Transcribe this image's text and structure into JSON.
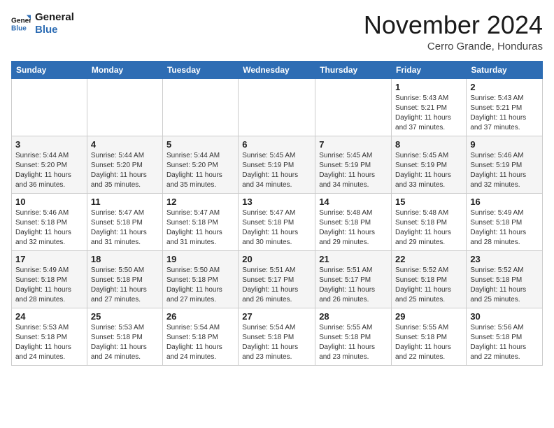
{
  "logo": {
    "line1": "General",
    "line2": "Blue"
  },
  "title": "November 2024",
  "subtitle": "Cerro Grande, Honduras",
  "header_days": [
    "Sunday",
    "Monday",
    "Tuesday",
    "Wednesday",
    "Thursday",
    "Friday",
    "Saturday"
  ],
  "weeks": [
    [
      {
        "day": "",
        "info": ""
      },
      {
        "day": "",
        "info": ""
      },
      {
        "day": "",
        "info": ""
      },
      {
        "day": "",
        "info": ""
      },
      {
        "day": "",
        "info": ""
      },
      {
        "day": "1",
        "info": "Sunrise: 5:43 AM\nSunset: 5:21 PM\nDaylight: 11 hours and 37 minutes."
      },
      {
        "day": "2",
        "info": "Sunrise: 5:43 AM\nSunset: 5:21 PM\nDaylight: 11 hours and 37 minutes."
      }
    ],
    [
      {
        "day": "3",
        "info": "Sunrise: 5:44 AM\nSunset: 5:20 PM\nDaylight: 11 hours and 36 minutes."
      },
      {
        "day": "4",
        "info": "Sunrise: 5:44 AM\nSunset: 5:20 PM\nDaylight: 11 hours and 35 minutes."
      },
      {
        "day": "5",
        "info": "Sunrise: 5:44 AM\nSunset: 5:20 PM\nDaylight: 11 hours and 35 minutes."
      },
      {
        "day": "6",
        "info": "Sunrise: 5:45 AM\nSunset: 5:19 PM\nDaylight: 11 hours and 34 minutes."
      },
      {
        "day": "7",
        "info": "Sunrise: 5:45 AM\nSunset: 5:19 PM\nDaylight: 11 hours and 34 minutes."
      },
      {
        "day": "8",
        "info": "Sunrise: 5:45 AM\nSunset: 5:19 PM\nDaylight: 11 hours and 33 minutes."
      },
      {
        "day": "9",
        "info": "Sunrise: 5:46 AM\nSunset: 5:19 PM\nDaylight: 11 hours and 32 minutes."
      }
    ],
    [
      {
        "day": "10",
        "info": "Sunrise: 5:46 AM\nSunset: 5:18 PM\nDaylight: 11 hours and 32 minutes."
      },
      {
        "day": "11",
        "info": "Sunrise: 5:47 AM\nSunset: 5:18 PM\nDaylight: 11 hours and 31 minutes."
      },
      {
        "day": "12",
        "info": "Sunrise: 5:47 AM\nSunset: 5:18 PM\nDaylight: 11 hours and 31 minutes."
      },
      {
        "day": "13",
        "info": "Sunrise: 5:47 AM\nSunset: 5:18 PM\nDaylight: 11 hours and 30 minutes."
      },
      {
        "day": "14",
        "info": "Sunrise: 5:48 AM\nSunset: 5:18 PM\nDaylight: 11 hours and 29 minutes."
      },
      {
        "day": "15",
        "info": "Sunrise: 5:48 AM\nSunset: 5:18 PM\nDaylight: 11 hours and 29 minutes."
      },
      {
        "day": "16",
        "info": "Sunrise: 5:49 AM\nSunset: 5:18 PM\nDaylight: 11 hours and 28 minutes."
      }
    ],
    [
      {
        "day": "17",
        "info": "Sunrise: 5:49 AM\nSunset: 5:18 PM\nDaylight: 11 hours and 28 minutes."
      },
      {
        "day": "18",
        "info": "Sunrise: 5:50 AM\nSunset: 5:18 PM\nDaylight: 11 hours and 27 minutes."
      },
      {
        "day": "19",
        "info": "Sunrise: 5:50 AM\nSunset: 5:18 PM\nDaylight: 11 hours and 27 minutes."
      },
      {
        "day": "20",
        "info": "Sunrise: 5:51 AM\nSunset: 5:17 PM\nDaylight: 11 hours and 26 minutes."
      },
      {
        "day": "21",
        "info": "Sunrise: 5:51 AM\nSunset: 5:17 PM\nDaylight: 11 hours and 26 minutes."
      },
      {
        "day": "22",
        "info": "Sunrise: 5:52 AM\nSunset: 5:18 PM\nDaylight: 11 hours and 25 minutes."
      },
      {
        "day": "23",
        "info": "Sunrise: 5:52 AM\nSunset: 5:18 PM\nDaylight: 11 hours and 25 minutes."
      }
    ],
    [
      {
        "day": "24",
        "info": "Sunrise: 5:53 AM\nSunset: 5:18 PM\nDaylight: 11 hours and 24 minutes."
      },
      {
        "day": "25",
        "info": "Sunrise: 5:53 AM\nSunset: 5:18 PM\nDaylight: 11 hours and 24 minutes."
      },
      {
        "day": "26",
        "info": "Sunrise: 5:54 AM\nSunset: 5:18 PM\nDaylight: 11 hours and 24 minutes."
      },
      {
        "day": "27",
        "info": "Sunrise: 5:54 AM\nSunset: 5:18 PM\nDaylight: 11 hours and 23 minutes."
      },
      {
        "day": "28",
        "info": "Sunrise: 5:55 AM\nSunset: 5:18 PM\nDaylight: 11 hours and 23 minutes."
      },
      {
        "day": "29",
        "info": "Sunrise: 5:55 AM\nSunset: 5:18 PM\nDaylight: 11 hours and 22 minutes."
      },
      {
        "day": "30",
        "info": "Sunrise: 5:56 AM\nSunset: 5:18 PM\nDaylight: 11 hours and 22 minutes."
      }
    ]
  ]
}
